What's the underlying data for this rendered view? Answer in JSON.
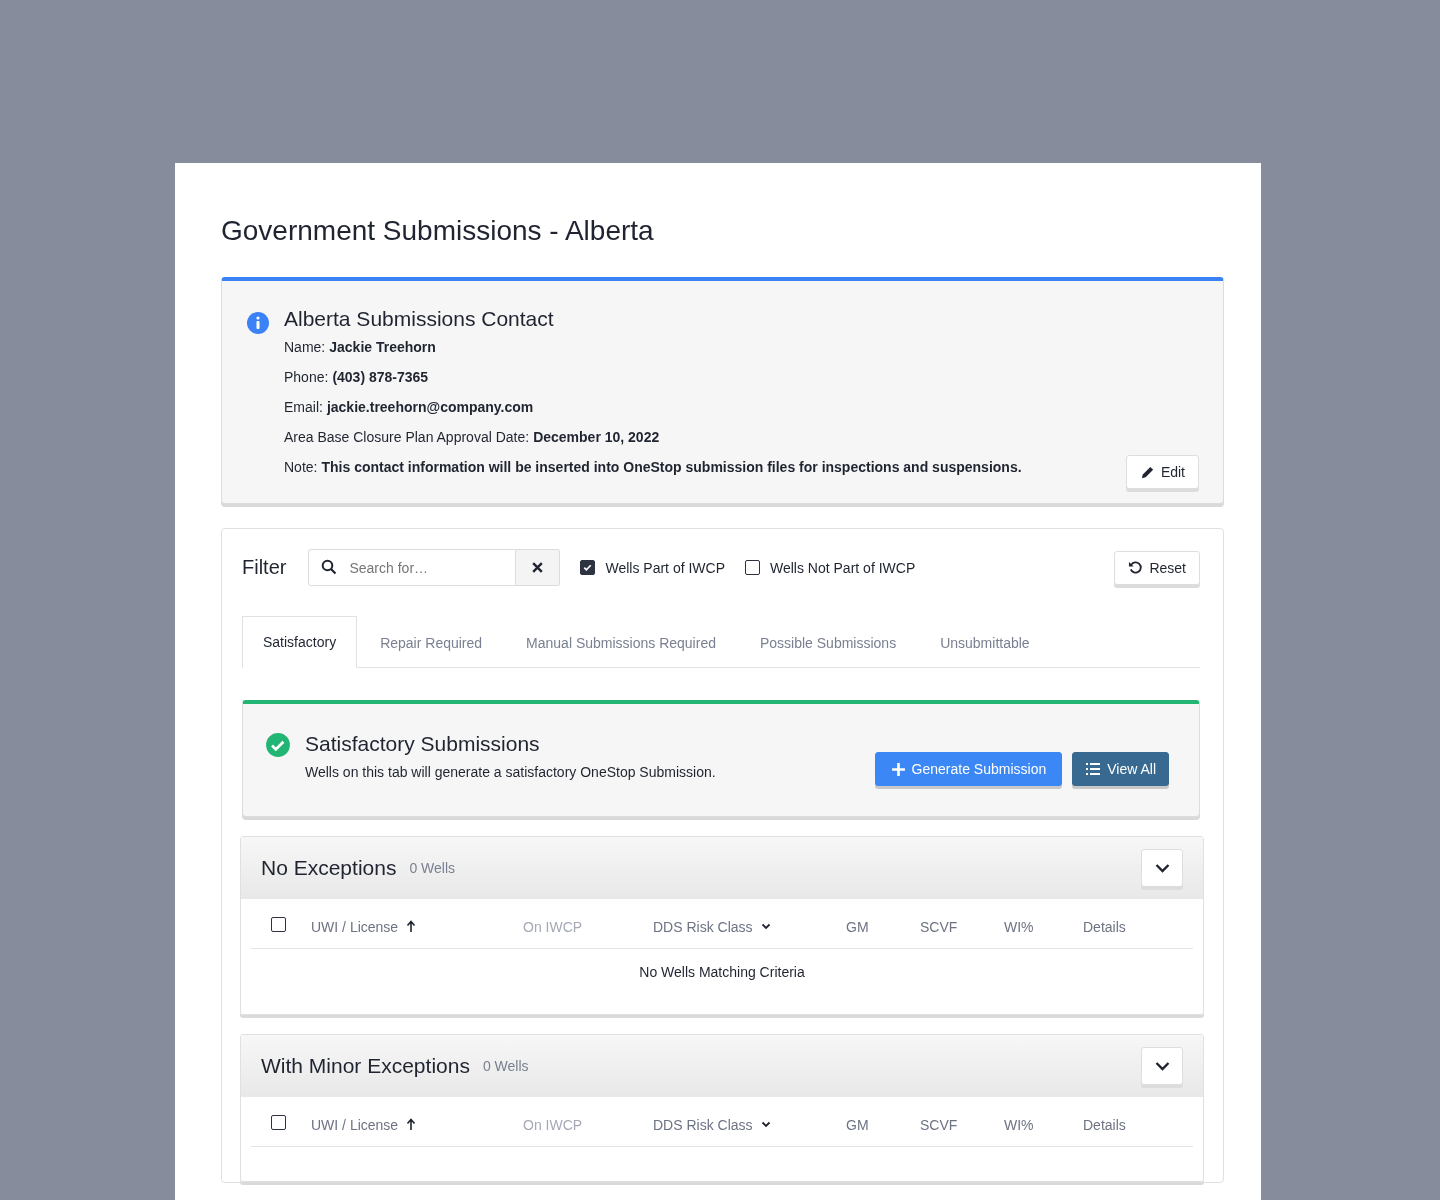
{
  "page": {
    "title": "Government Submissions - Alberta"
  },
  "contact": {
    "title": "Alberta Submissions Contact",
    "fields": [
      {
        "label": "Name:",
        "value": "Jackie Treehorn"
      },
      {
        "label": "Phone:",
        "value": "(403) 878-7365"
      },
      {
        "label": "Email:",
        "value": "jackie.treehorn@company.com"
      },
      {
        "label": "Area Base Closure Plan Approval Date:",
        "value": "December 10, 2022"
      },
      {
        "label": "Note:",
        "value": "This contact information will be inserted into OneStop submission files for inspections and suspensions."
      }
    ],
    "edit_button": "Edit"
  },
  "filter": {
    "label": "Filter",
    "search": {
      "placeholder": "Search for…"
    },
    "checkboxes": [
      {
        "label": "Wells Part of IWCP",
        "checked": true
      },
      {
        "label": "Wells Not Part of IWCP",
        "checked": false
      }
    ],
    "reset_button": "Reset"
  },
  "tabs": [
    {
      "label": "Satisfactory",
      "selected": true
    },
    {
      "label": "Repair Required",
      "selected": false
    },
    {
      "label": "Manual Submissions Required",
      "selected": false
    },
    {
      "label": "Possible Submissions",
      "selected": false
    },
    {
      "label": "Unsubmittable",
      "selected": false
    }
  ],
  "alert": {
    "title": "Satisfactory Submissions",
    "text": "Wells on this tab will generate a satisfactory OneStop Submission.",
    "primary_button": "Generate Submission",
    "secondary_button": "View All"
  },
  "sections": [
    {
      "title": "No Exceptions",
      "count": "0 Wells",
      "select_all": false,
      "columns": [
        {
          "label": "UWI / License",
          "kind": "sorted",
          "disabled": false
        },
        {
          "label": "On IWCP",
          "kind": "plain",
          "disabled": true
        },
        {
          "label": "DDS Risk Class",
          "kind": "dropdown",
          "disabled": false
        },
        {
          "label": "GM",
          "kind": "plain",
          "disabled": false
        },
        {
          "label": "SCVF",
          "kind": "plain",
          "disabled": false
        },
        {
          "label": "WI%",
          "kind": "plain",
          "disabled": false
        },
        {
          "label": "Details",
          "kind": "plain",
          "disabled": false
        }
      ],
      "empty_message": "No Wells Matching Criteria"
    },
    {
      "title": "With Minor Exceptions",
      "count": "0 Wells",
      "select_all": false,
      "columns": [
        {
          "label": "UWI / License",
          "kind": "sorted",
          "disabled": false
        },
        {
          "label": "On IWCP",
          "kind": "plain",
          "disabled": true
        },
        {
          "label": "DDS Risk Class",
          "kind": "dropdown",
          "disabled": false
        },
        {
          "label": "GM",
          "kind": "plain",
          "disabled": false
        },
        {
          "label": "SCVF",
          "kind": "plain",
          "disabled": false
        },
        {
          "label": "WI%",
          "kind": "plain",
          "disabled": false
        },
        {
          "label": "Details",
          "kind": "plain",
          "disabled": false
        }
      ]
    }
  ]
}
